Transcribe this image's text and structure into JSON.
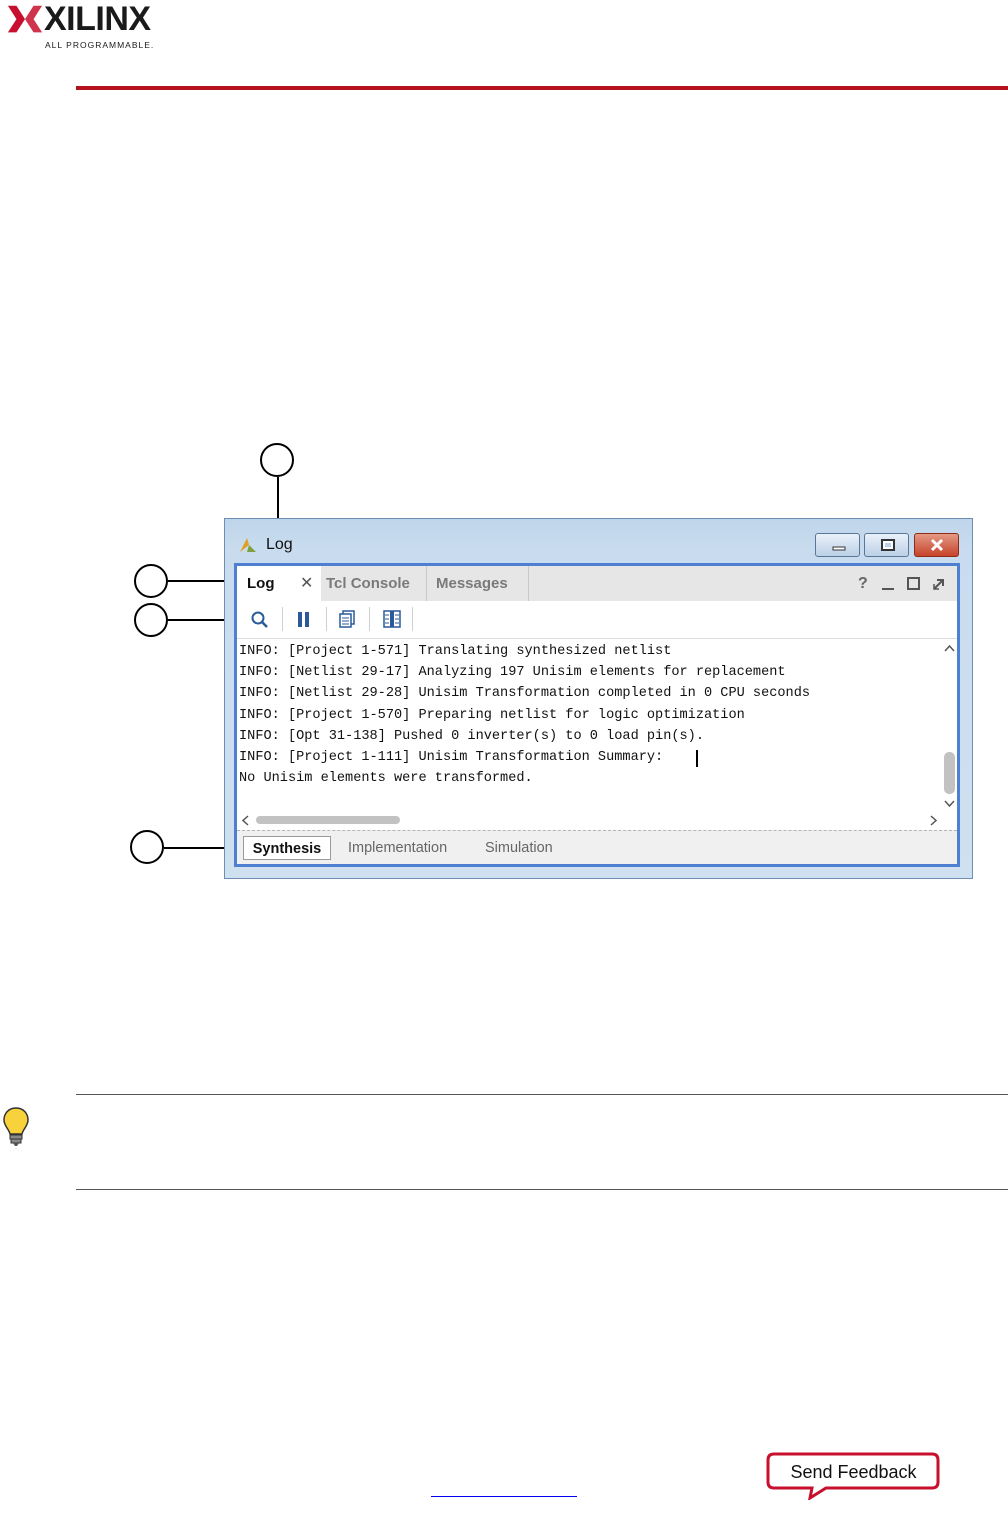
{
  "header": {
    "logo_word": "XILINX",
    "logo_tagline": "ALL PROGRAMMABLE.",
    "rule_color": "#b5121b"
  },
  "window": {
    "title": "Log",
    "tabs": [
      {
        "label": "Log",
        "active": true,
        "closable": true
      },
      {
        "label": "Tcl Console",
        "active": false
      },
      {
        "label": "Messages",
        "active": false
      }
    ],
    "tab_controls": [
      "?",
      "minimize-icon",
      "maximize-icon",
      "float-icon"
    ],
    "toolbar_icons": [
      "search-icon",
      "pause-icon",
      "copy-icon",
      "columns-icon"
    ],
    "log_lines": [
      "INFO: [Project 1-571] Translating synthesized netlist",
      "INFO: [Netlist 29-17] Analyzing 197 Unisim elements for replacement",
      "INFO: [Netlist 29-28] Unisim Transformation completed in 0 CPU seconds",
      "INFO: [Project 1-570] Preparing netlist for logic optimization",
      "INFO: [Opt 31-138] Pushed 0 inverter(s) to 0 load pin(s).",
      "INFO: [Project 1-111] Unisim Transformation Summary:",
      "No Unisim elements were transformed."
    ],
    "bottom_tabs": [
      {
        "label": "Synthesis",
        "active": true
      },
      {
        "label": "Implementation",
        "active": false
      },
      {
        "label": "Simulation",
        "active": false
      }
    ],
    "accent_color": "#4f7fd0"
  },
  "footer": {
    "send_feedback": "Send Feedback"
  }
}
